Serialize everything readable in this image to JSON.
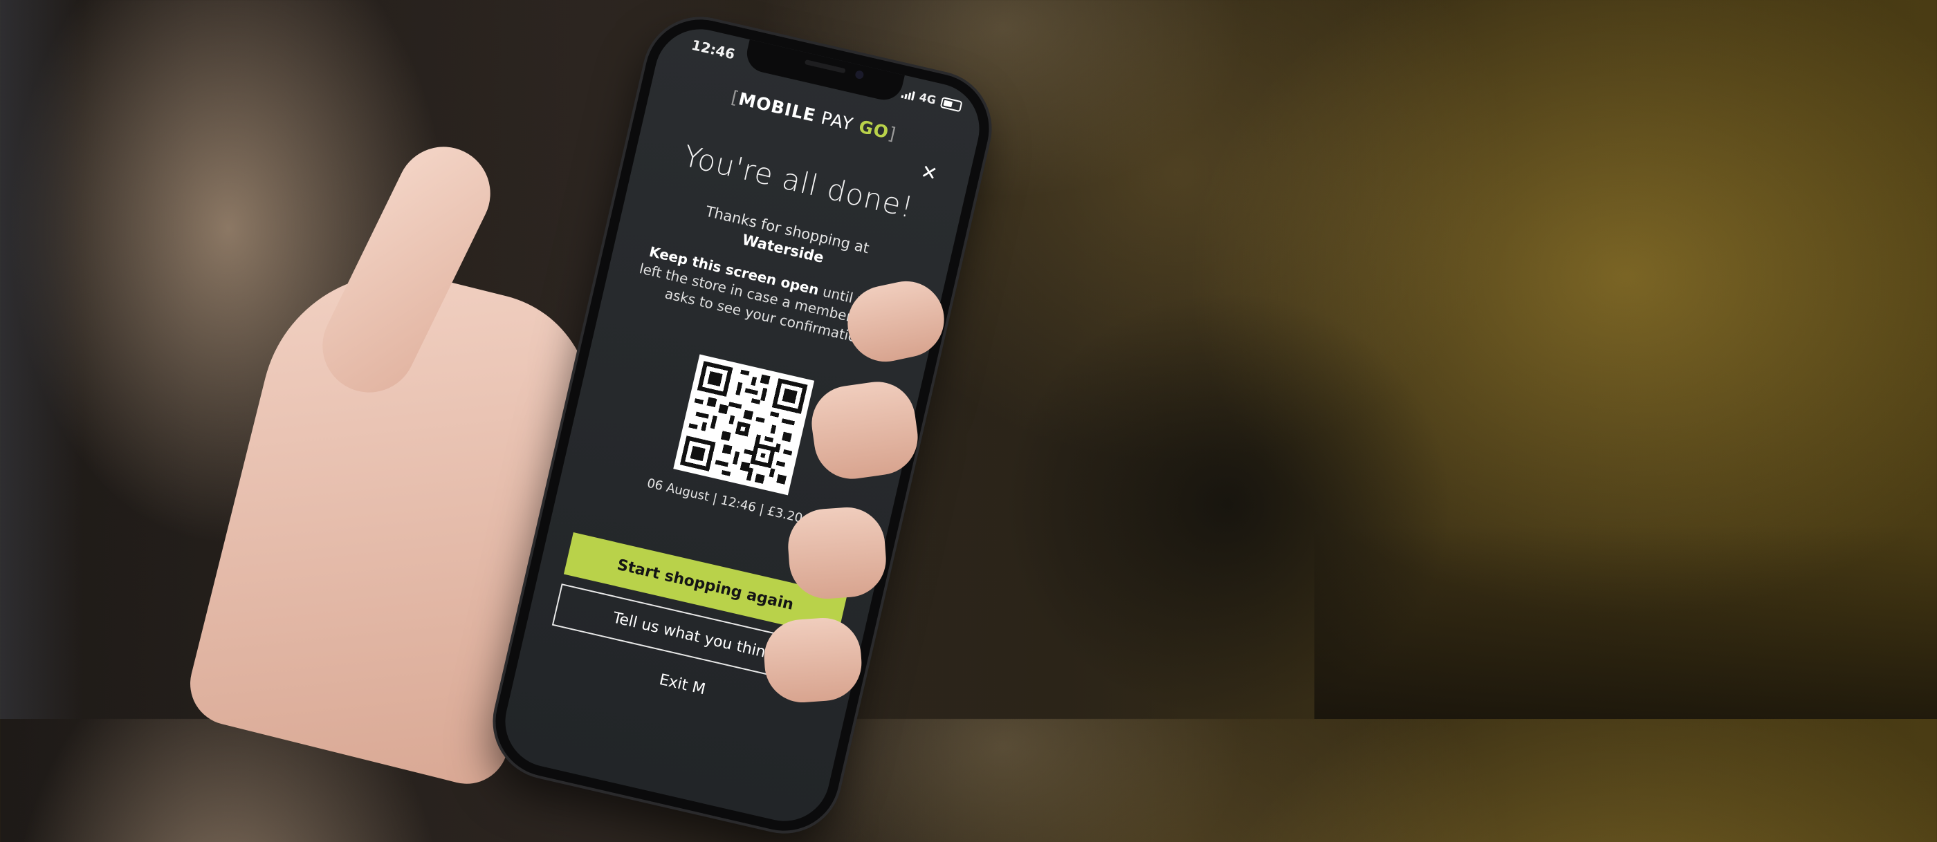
{
  "colors": {
    "accent": "#b9d24a",
    "screen_bg": "#25282b",
    "text": "#f1f1f1"
  },
  "status_bar": {
    "time": "12:46",
    "network": "4G"
  },
  "header": {
    "logo_mobile": "MOBILE",
    "logo_pay": "PAY",
    "logo_go": "GO",
    "close_icon": "close-icon"
  },
  "main": {
    "title": "You're all done!",
    "thanks_line": "Thanks for shopping at",
    "store_name": "Waterside",
    "note_bold": "Keep this screen open",
    "note_rest": " until you've left the store in case a member of staff asks to see your confirmation.",
    "receipt_info": "06 August | 12:46 | £3.20"
  },
  "actions": {
    "primary_label": "Start shopping again",
    "feedback_label": "Tell us what you think",
    "exit_label": "Exit M"
  }
}
